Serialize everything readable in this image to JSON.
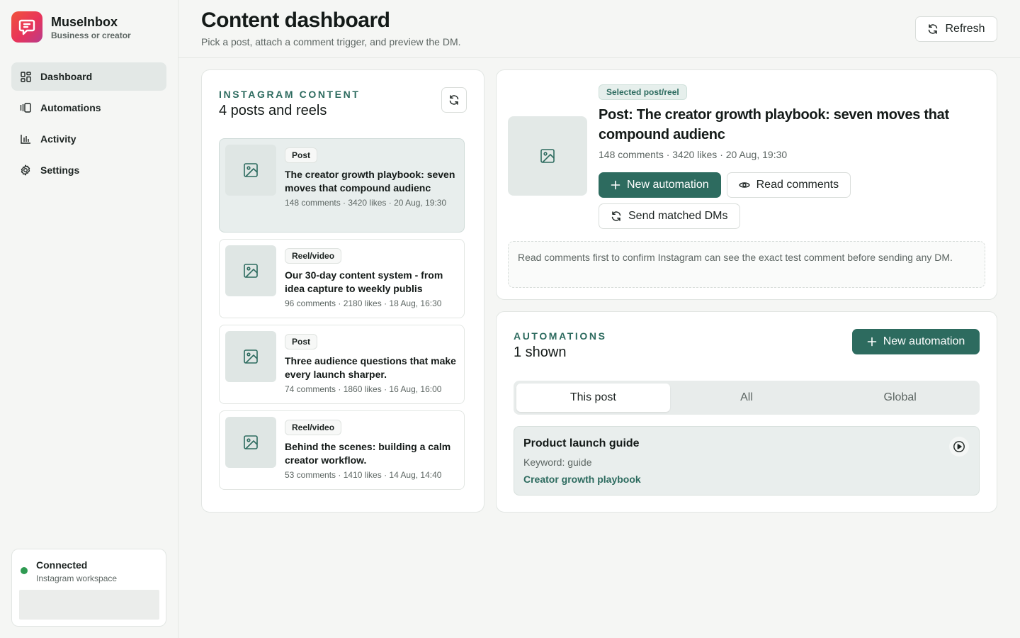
{
  "brand": {
    "name": "MuseInbox",
    "subtitle": "Business or creator"
  },
  "nav": [
    {
      "label": "Dashboard",
      "icon": "dashboard-icon",
      "active": true
    },
    {
      "label": "Automations",
      "icon": "automations-icon"
    },
    {
      "label": "Activity",
      "icon": "activity-chart-icon"
    },
    {
      "label": "Settings",
      "icon": "gear-icon"
    }
  ],
  "connection": {
    "status": "Connected",
    "workspace": "Instagram workspace",
    "status_color": "#2f9a52"
  },
  "header": {
    "title": "Content dashboard",
    "subtitle": "Pick a post, attach a comment trigger, and preview the DM.",
    "refresh_label": "Refresh"
  },
  "content": {
    "eyebrow": "INSTAGRAM CONTENT",
    "title": "4 posts and reels",
    "posts": [
      {
        "type": "Post",
        "title": "The creator growth playbook: seven moves that compound audienc",
        "meta": "148 comments · 3420 likes · 20 Aug, 19:30"
      },
      {
        "type": "Reel/video",
        "title": "Our 30-day content system - from idea capture to weekly publis",
        "meta": "96 comments · 2180 likes · 18 Aug, 16:30"
      },
      {
        "type": "Post",
        "title": "Three audience questions that make every launch sharper.",
        "meta": "74 comments · 1860 likes · 16 Aug, 16:00"
      },
      {
        "type": "Reel/video",
        "title": "Behind the scenes: building a calm creator workflow.",
        "meta": "53 comments · 1410 likes · 14 Aug, 14:40"
      }
    ]
  },
  "selected": {
    "badge": "Selected post/reel",
    "title": "Post: The creator growth playbook: seven moves that compound audienc",
    "meta": "148 comments · 3420 likes · 20 Aug, 19:30",
    "new_automation_label": "New automation",
    "read_comments_label": "Read comments",
    "send_dms_label": "Send matched DMs",
    "notice": "Read comments first to confirm Instagram can see the exact test comment before sending any DM."
  },
  "automations": {
    "eyebrow": "AUTOMATIONS",
    "title": "1 shown",
    "new_label": "New automation",
    "tabs": [
      {
        "label": "This post",
        "active": true
      },
      {
        "label": "All"
      },
      {
        "label": "Global"
      }
    ],
    "items": [
      {
        "name": "Product launch guide",
        "keyword": "Keyword: guide",
        "post": "Creator growth playbook"
      }
    ]
  },
  "colors": {
    "accent": "#2d6b5f",
    "background": "#f5f6f4",
    "card": "#ffffff"
  }
}
